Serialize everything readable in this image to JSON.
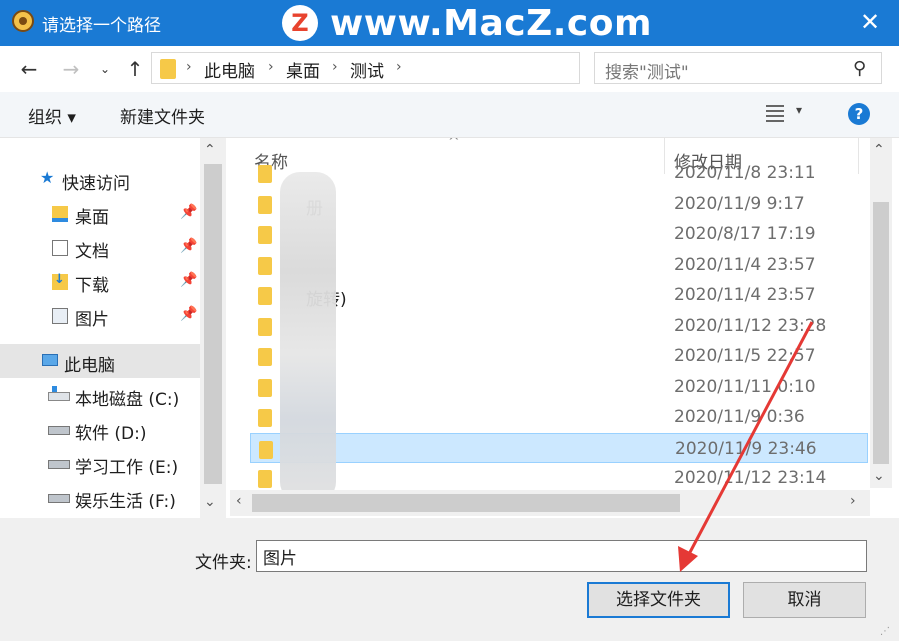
{
  "window": {
    "title": "请选择一个路径",
    "close_glyph": "✕"
  },
  "watermark": {
    "logo_letter": "Z",
    "text": "www.MacZ.com"
  },
  "address": {
    "crumbs": [
      "此电脑",
      "桌面",
      "测试"
    ],
    "search_placeholder": "搜索\"测试\""
  },
  "toolbar": {
    "organize": "组织 ▾",
    "new_folder": "新建文件夹",
    "help": "?"
  },
  "nav": {
    "quick_access": "快速访问",
    "quick_items": [
      "桌面",
      "文档",
      "下载",
      "图片"
    ],
    "this_pc": "此电脑",
    "drives": [
      "本地磁盘 (C:)",
      "软件 (D:)",
      "学习工作 (E:)",
      "娱乐生活 (F:)"
    ]
  },
  "columns": {
    "name": "名称",
    "date": "修改日期"
  },
  "files": [
    {
      "name": "",
      "date": "2020/11/8 23:11"
    },
    {
      "name": "册",
      "date": "2020/11/9 9:17"
    },
    {
      "name": "",
      "date": "2020/8/17 17:19"
    },
    {
      "name": "",
      "date": "2020/11/4 23:57"
    },
    {
      "name": "旋转)",
      "date": "2020/11/4 23:57"
    },
    {
      "name": "",
      "date": "2020/11/12 23:28"
    },
    {
      "name": "",
      "date": "2020/11/5 22:57"
    },
    {
      "name": "",
      "date": "2020/11/11 0:10"
    },
    {
      "name": "",
      "date": "2020/11/9 0:36"
    },
    {
      "name": "",
      "date": "2020/11/9 23:46"
    },
    {
      "name": "",
      "date": "2020/11/12 23:14"
    }
  ],
  "selected_index": 9,
  "bottom": {
    "folder_label": "文件夹:",
    "folder_value": "图片",
    "select_button": "选择文件夹",
    "cancel_button": "取消"
  },
  "colors": {
    "accent": "#1a7ad4",
    "selection": "#cce8ff",
    "arrow": "#e53935"
  }
}
